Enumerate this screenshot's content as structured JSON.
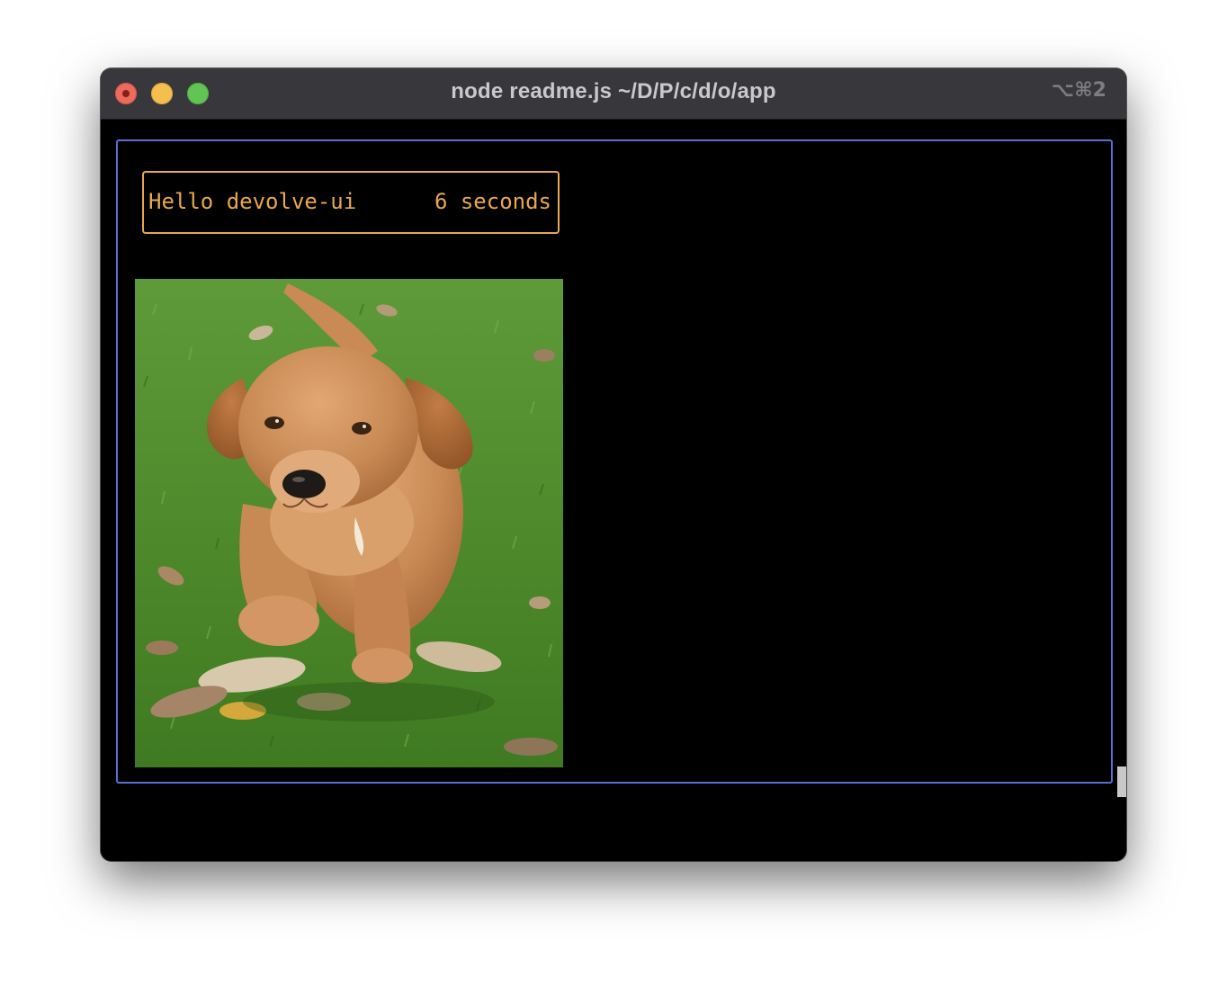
{
  "window": {
    "title": "node readme.js ~/D/P/c/d/o/app",
    "shortcut": "⌥⌘2"
  },
  "app": {
    "greeting": "Hello devolve-ui",
    "timer": "6 seconds"
  },
  "image": {
    "subject": "golden retriever puppy walking on grass with fallen leaves"
  },
  "colors": {
    "outer_border": "#5a6fd4",
    "header_accent": "#e8a84e",
    "terminal_bg": "#000000",
    "titlebar_bg": "#38373c"
  }
}
